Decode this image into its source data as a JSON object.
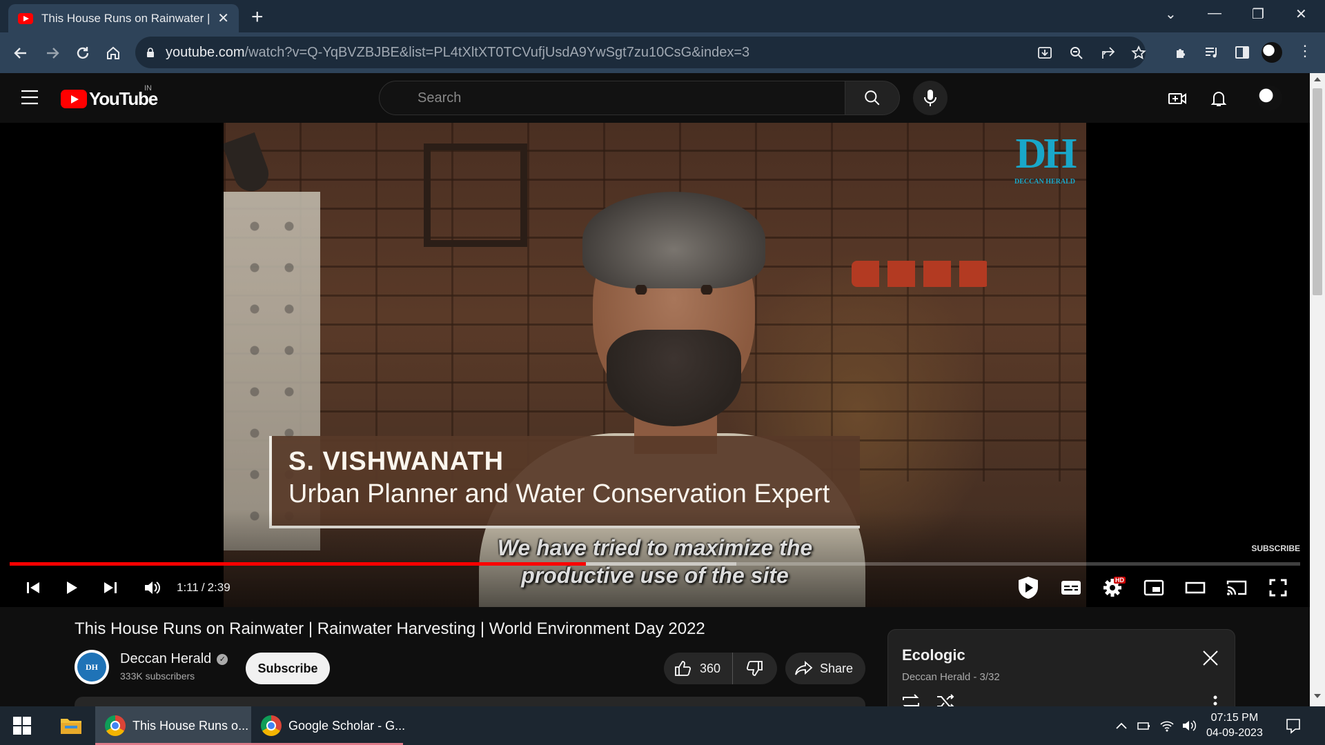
{
  "browser": {
    "tab_title": "This House Runs on Rainwater | R",
    "url_host": "youtube.com",
    "url_path": "/watch?v=Q-YqBVZBJBE&list=PL4tXltXT0TCVufjUsdA9YwSgt7zu10CsG&index=3"
  },
  "youtube": {
    "logo_text": "YouTube",
    "country_code": "IN",
    "search_placeholder": "Search"
  },
  "player": {
    "brand_logo": "DH",
    "brand_logo_sub": "DECCAN HERALD",
    "lower_third_name": "S. VISHWANATH",
    "lower_third_role": "Urban Planner and Water Conservation Expert",
    "caption_line1": "We have tried to maximize the",
    "caption_line2": "productive use of the site",
    "subscribe_watermark": "SUBSCRIBE",
    "current_time": "1:11",
    "time_separator": "/",
    "duration": "2:39",
    "progress_fraction": 0.4465,
    "buffered_fraction": 0.563,
    "hd_badge": "HD"
  },
  "video": {
    "title": "This House Runs on Rainwater | Rainwater Harvesting | World Environment Day 2022",
    "channel_name": "Deccan Herald",
    "channel_avatar_text": "DH",
    "subscribers": "333K subscribers",
    "subscribe_label": "Subscribe",
    "like_count": "360",
    "share_label": "Share"
  },
  "playlist": {
    "title": "Ecologic",
    "subtitle": "Deccan Herald - 3/32"
  },
  "taskbar": {
    "task1_label": "This House Runs o...",
    "task2_label": "Google Scholar - G...",
    "time": "07:15 PM",
    "date": "04-09-2023"
  },
  "colors": {
    "accent_red": "#ff0000",
    "tab_strip": "#1c2b3b",
    "toolbar": "#2e4359",
    "page_bg": "#0f0f0f"
  }
}
